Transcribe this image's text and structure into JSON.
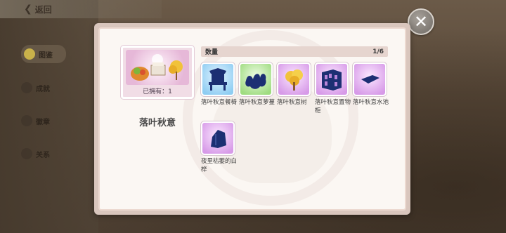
{
  "header": {
    "back_label": "返回"
  },
  "sidebar": {
    "items": [
      {
        "label": "图鉴",
        "active": true
      },
      {
        "label": "成就",
        "active": false
      },
      {
        "label": "徽章",
        "active": false
      },
      {
        "label": "关系",
        "active": false
      }
    ]
  },
  "close_icon": "✕",
  "dialog": {
    "set_name": "落叶秋意",
    "owned_label": "已拥有：1",
    "quantity_label": "数量",
    "quantity_count": "1/6",
    "items": [
      {
        "name": "落叶秋意餐椅",
        "color": "blue",
        "icon": "chair-icon"
      },
      {
        "name": "落叶秋意萝蔓",
        "color": "green",
        "icon": "vine-icon"
      },
      {
        "name": "落叶秋意树",
        "color": "purple",
        "icon": "tree-icon"
      },
      {
        "name": "落叶秋意置物柜",
        "color": "purple",
        "icon": "shelf-icon"
      },
      {
        "name": "落叶秋意水池",
        "color": "purple",
        "icon": "pond-icon"
      },
      {
        "name": "夜里枯萎的白桦",
        "color": "purple",
        "icon": "birch-icon"
      }
    ]
  },
  "colors": {
    "dialog_border": "#d9c6bd",
    "dialog_bg": "#fbf7f3",
    "silhouette": "#1c2f73",
    "tree_gold": "#f1c23a"
  }
}
